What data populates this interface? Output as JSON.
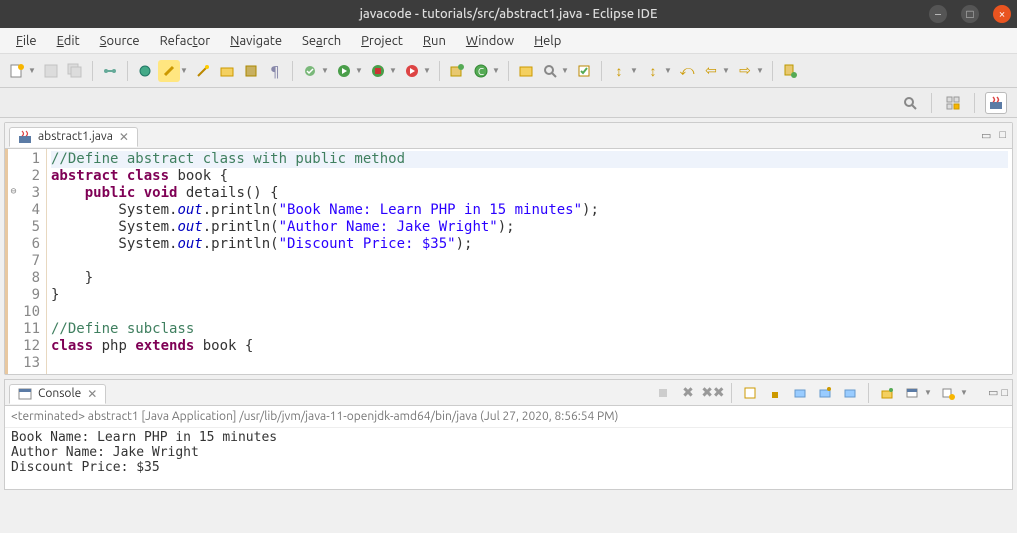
{
  "window": {
    "title": "javacode - tutorials/src/abstract1.java - Eclipse IDE"
  },
  "menus": [
    "File",
    "Edit",
    "Source",
    "Refactor",
    "Navigate",
    "Search",
    "Project",
    "Run",
    "Window",
    "Help"
  ],
  "editor": {
    "tab_label": "abstract1.java",
    "code": {
      "l1": "//Define abstract class with public method",
      "l2a": "abstract",
      "l2b": "class",
      "l2c": " book {",
      "l3a": "public",
      "l3b": "void",
      "l3c": " details() {",
      "l4pre": "        System.",
      "l4out": "out",
      "l4mid": ".println(",
      "l4str": "\"Book Name: Learn PHP in 15 minutes\"",
      "l4end": ");",
      "l5pre": "        System.",
      "l5out": "out",
      "l5mid": ".println(",
      "l5str": "\"Author Name: Jake Wright\"",
      "l5end": ");",
      "l6pre": "        System.",
      "l6out": "out",
      "l6mid": ".println(",
      "l6str": "\"Discount Price: $35\"",
      "l6end": ");",
      "l7": "",
      "l8": "    }",
      "l9": "}",
      "l10": "",
      "l11": "//Define subclass",
      "l12a": "class",
      "l12b": " php ",
      "l12c": "extends",
      "l12d": " book {",
      "l13": ""
    },
    "line_numbers": [
      "1",
      "2",
      "3",
      "4",
      "5",
      "6",
      "7",
      "8",
      "9",
      "10",
      "11",
      "12",
      "13"
    ]
  },
  "console": {
    "tab_label": "Console",
    "status_prefix": "<terminated>",
    "status_rest": " abstract1 [Java Application] /usr/lib/jvm/java-11-openjdk-amd64/bin/java (Jul 27, 2020, 8:56:54 PM)",
    "out1": "Book Name: Learn PHP in 15 minutes",
    "out2": "Author Name: Jake Wright",
    "out3": "Discount Price: $35"
  }
}
